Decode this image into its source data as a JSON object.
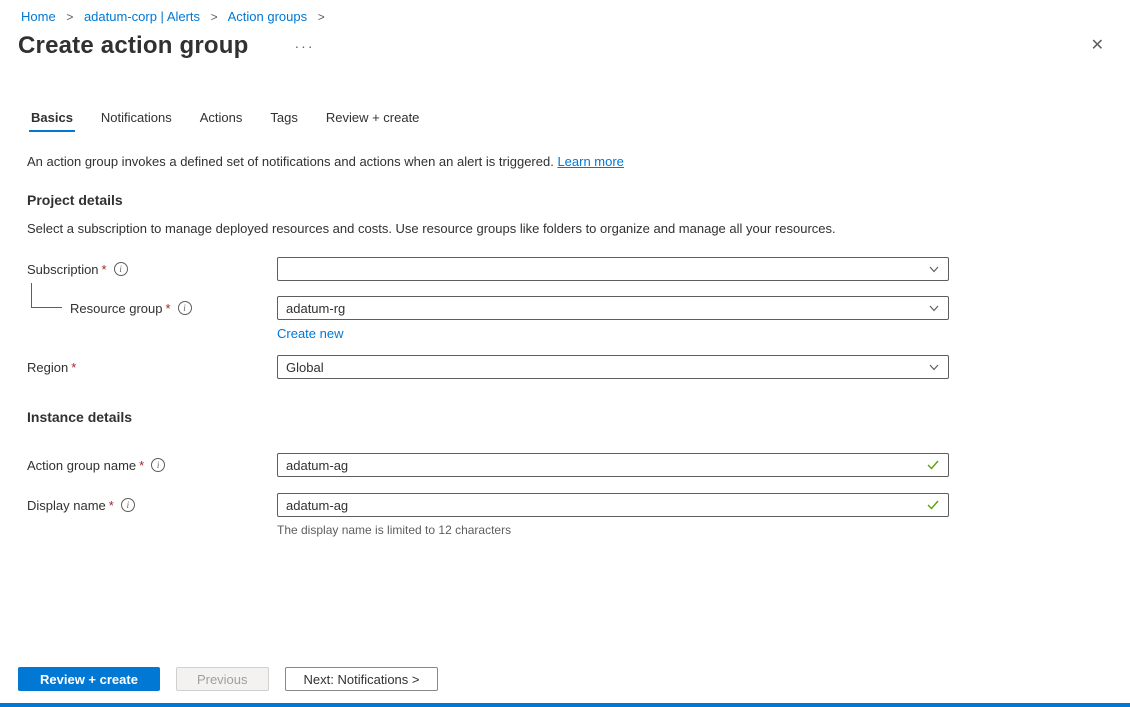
{
  "breadcrumb": {
    "separator": ">",
    "items": [
      {
        "label": "Home"
      },
      {
        "label": "adatum-corp | Alerts"
      },
      {
        "label": "Action groups"
      }
    ]
  },
  "header": {
    "title": "Create action group",
    "more_options": "···",
    "close_icon": "✕"
  },
  "tabs": [
    {
      "label": "Basics",
      "active": true
    },
    {
      "label": "Notifications",
      "active": false
    },
    {
      "label": "Actions",
      "active": false
    },
    {
      "label": "Tags",
      "active": false
    },
    {
      "label": "Review + create",
      "active": false
    }
  ],
  "intro": {
    "text": "An action group invokes a defined set of notifications and actions when an alert is triggered. ",
    "link": "Learn more"
  },
  "project_details": {
    "heading": "Project details",
    "description": "Select a subscription to manage deployed resources and costs. Use resource groups like folders to organize and manage all your resources.",
    "subscription": {
      "label": "Subscription",
      "required": "*",
      "value": ""
    },
    "resource_group": {
      "label": "Resource group",
      "required": "*",
      "value": "adatum-rg",
      "create_new": "Create new"
    },
    "region": {
      "label": "Region",
      "required": "*",
      "value": "Global"
    }
  },
  "instance_details": {
    "heading": "Instance details",
    "action_group_name": {
      "label": "Action group name",
      "required": "*",
      "value": "adatum-ag"
    },
    "display_name": {
      "label": "Display name",
      "required": "*",
      "value": "adatum-ag",
      "helper": "The display name is limited to 12 characters"
    }
  },
  "footer": {
    "review_create": "Review + create",
    "previous": "Previous",
    "next": "Next: Notifications >"
  },
  "colors": {
    "accent": "#0078d4",
    "required": "#a4262c",
    "valid_check": "#57a300"
  }
}
